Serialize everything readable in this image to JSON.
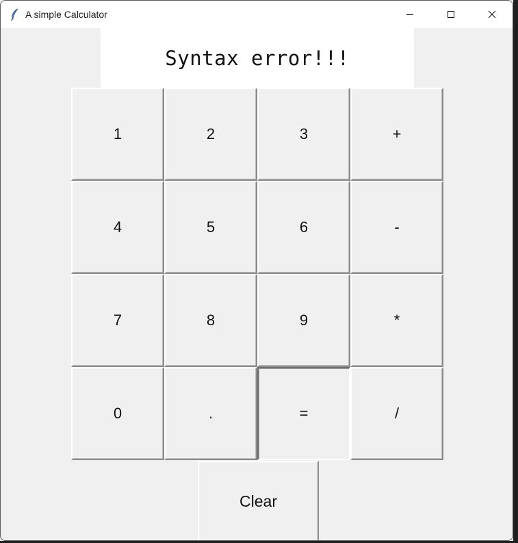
{
  "window": {
    "title": "A simple Calculator",
    "controls": {
      "minimize": "minimize-icon",
      "maximize": "maximize-icon",
      "close": "close-icon"
    },
    "app_icon": "feather-icon"
  },
  "display": {
    "text": "Syntax error!!!"
  },
  "keypad": {
    "rows": [
      [
        "1",
        "2",
        "3",
        "+"
      ],
      [
        "4",
        "5",
        "6",
        "-"
      ],
      [
        "7",
        "8",
        "9",
        "*"
      ],
      [
        "0",
        ".",
        "=",
        "/"
      ]
    ]
  },
  "clear": {
    "label": "Clear"
  },
  "colors": {
    "background": "#f0f0f0",
    "display_bg": "#ffffff",
    "titlebar_bg": "#ffffff"
  }
}
